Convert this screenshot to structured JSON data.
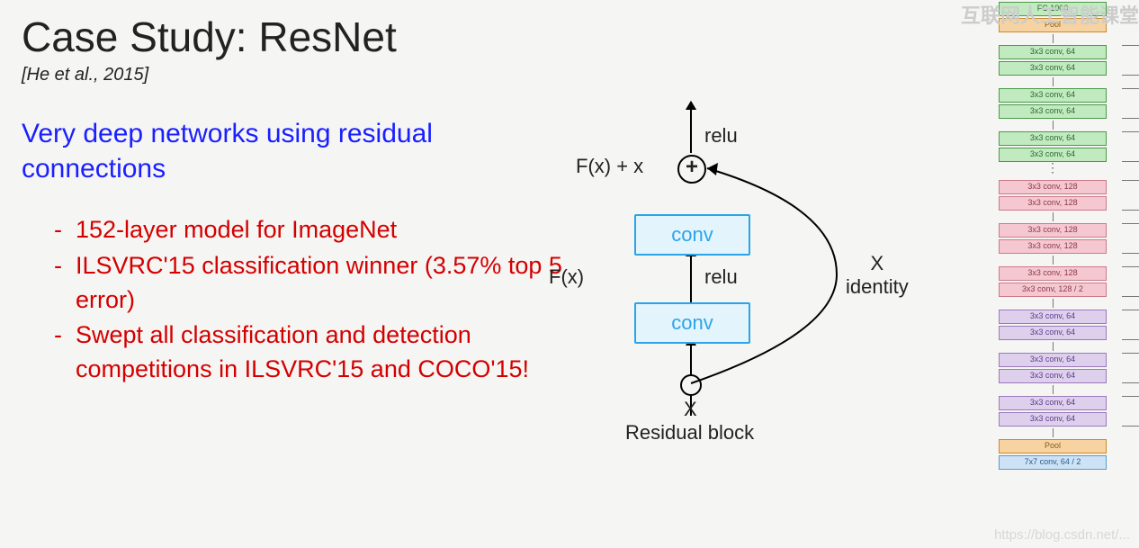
{
  "slide": {
    "title": "Case Study: ResNet",
    "citation": "[He et al., 2015]",
    "subtitle": "Very deep networks using residual connections",
    "bullets": [
      "152-layer model for ImageNet",
      "ILSVRC'15 classification winner (3.57% top 5 error)",
      "Swept all classification and detection competitions in ILSVRC'15 and COCO'15!"
    ]
  },
  "resblock": {
    "top_out": "relu",
    "sum_label": "F(x) + x",
    "plus": "+",
    "conv_top": "conv",
    "mid_relu": "relu",
    "conv_bot": "conv",
    "fx": "F(x)",
    "x_identity": "X\nidentity",
    "x_in": "X",
    "caption": "Residual block"
  },
  "arch": {
    "layers": [
      {
        "t": "FC 1000",
        "c": "green"
      },
      {
        "t": "Pool",
        "c": "orange"
      },
      {
        "gap": true
      },
      {
        "pair": [
          {
            "t": "3x3 conv, 64",
            "c": "green"
          },
          {
            "t": "3x3 conv, 64",
            "c": "green"
          }
        ]
      },
      {
        "gap": true
      },
      {
        "pair": [
          {
            "t": "3x3 conv, 64",
            "c": "green"
          },
          {
            "t": "3x3 conv, 64",
            "c": "green"
          }
        ]
      },
      {
        "gap": true
      },
      {
        "pair": [
          {
            "t": "3x3 conv, 64",
            "c": "green"
          },
          {
            "t": "3x3 conv, 64",
            "c": "green"
          }
        ]
      },
      {
        "dots": true
      },
      {
        "pair": [
          {
            "t": "3x3 conv, 128",
            "c": "pink"
          },
          {
            "t": "3x3 conv, 128",
            "c": "pink"
          }
        ]
      },
      {
        "gap": true
      },
      {
        "pair": [
          {
            "t": "3x3 conv, 128",
            "c": "pink"
          },
          {
            "t": "3x3 conv, 128",
            "c": "pink"
          }
        ]
      },
      {
        "gap": true
      },
      {
        "pair": [
          {
            "t": "3x3 conv, 128",
            "c": "pink"
          },
          {
            "t": "3x3 conv, 128 / 2",
            "c": "pink"
          }
        ]
      },
      {
        "gap": true
      },
      {
        "pair": [
          {
            "t": "3x3 conv, 64",
            "c": "purple"
          },
          {
            "t": "3x3 conv, 64",
            "c": "purple"
          }
        ]
      },
      {
        "gap": true
      },
      {
        "pair": [
          {
            "t": "3x3 conv, 64",
            "c": "purple"
          },
          {
            "t": "3x3 conv, 64",
            "c": "purple"
          }
        ]
      },
      {
        "gap": true
      },
      {
        "pair": [
          {
            "t": "3x3 conv, 64",
            "c": "purple"
          },
          {
            "t": "3x3 conv, 64",
            "c": "purple"
          }
        ]
      },
      {
        "gap": true
      },
      {
        "t": "Pool",
        "c": "orange"
      },
      {
        "t": "7x7 conv, 64 / 2",
        "c": "blue"
      }
    ]
  },
  "watermarks": {
    "top_right": "互联网人工智能课堂",
    "bottom_right": "https://blog.csdn.net/..."
  }
}
